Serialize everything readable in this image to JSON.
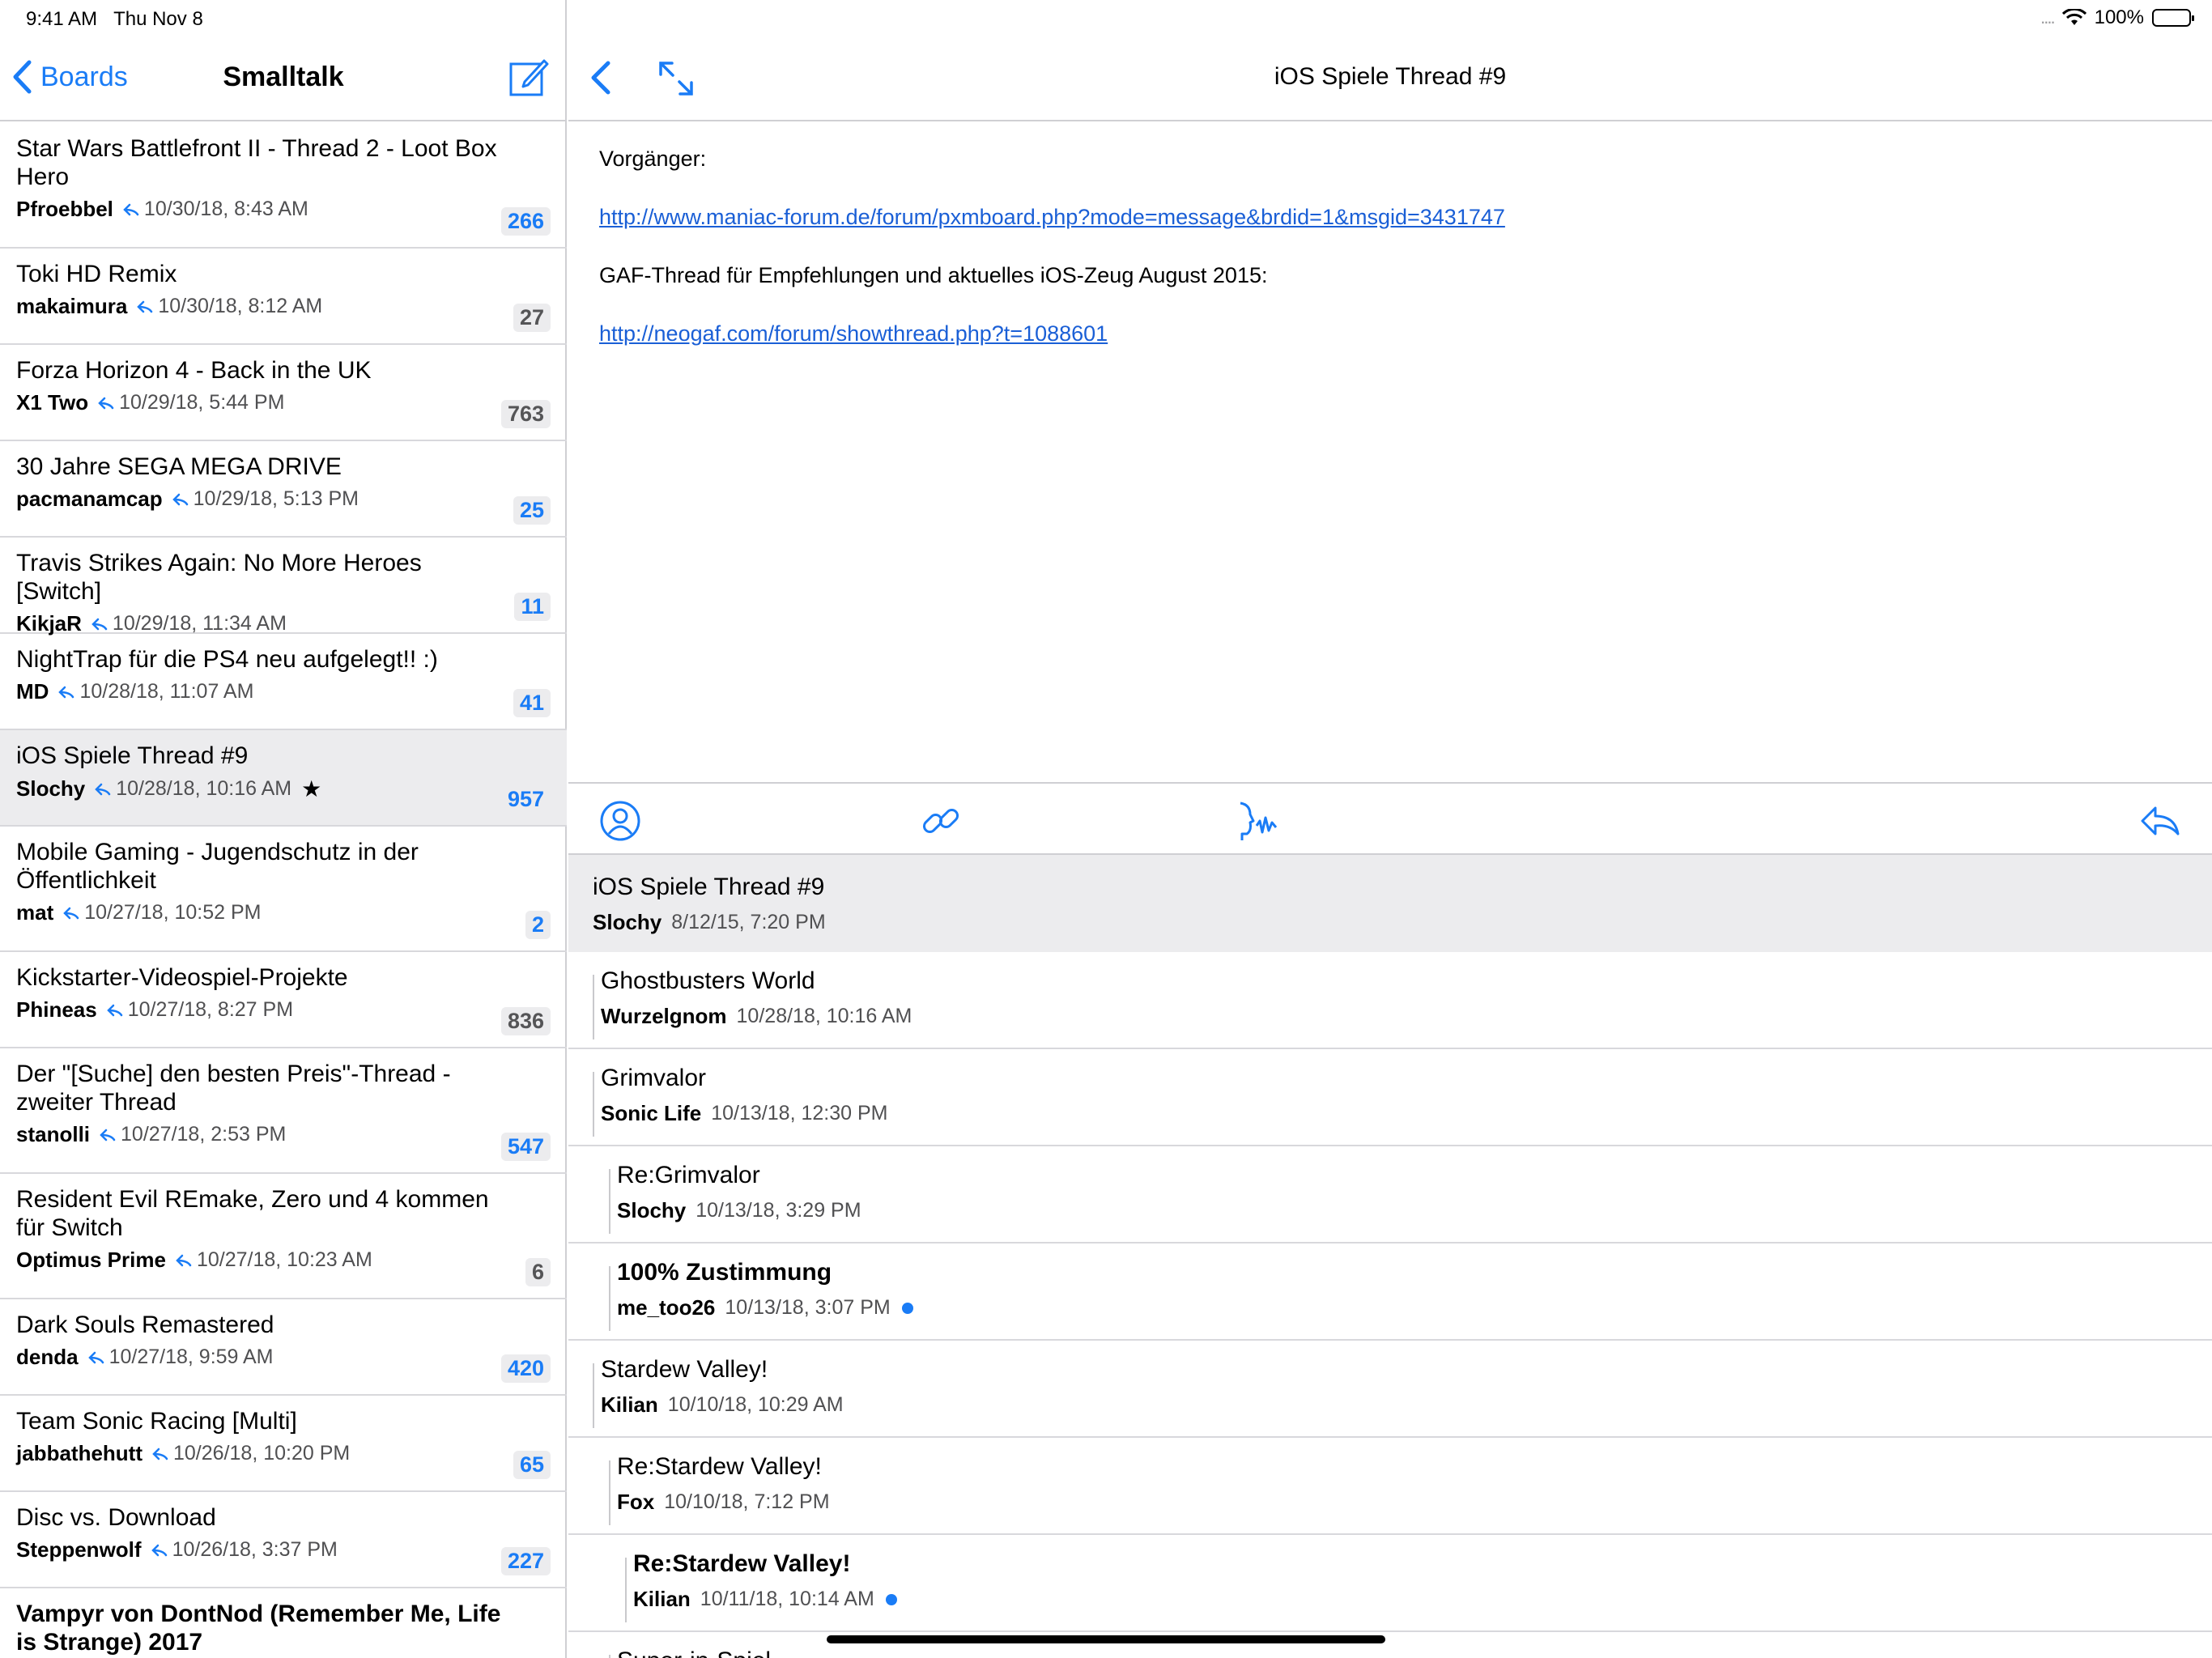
{
  "status_bar": {
    "time": "9:41 AM",
    "date": "Thu Nov 8",
    "signal": "....",
    "battery": "100%"
  },
  "sidebar": {
    "back_label": "Boards",
    "title": "Smalltalk",
    "threads": [
      {
        "title": "Star Wars Battlefront II - Thread 2 - Loot Box Hero",
        "author": "Pfroebbel",
        "date": "10/30/18, 8:43 AM",
        "count": "266",
        "count_color": "blue",
        "lines": 2
      },
      {
        "title": "Toki HD Remix",
        "author": "makaimura",
        "date": "10/30/18, 8:12 AM",
        "count": "27",
        "count_color": "gray",
        "lines": 1
      },
      {
        "title": "Forza Horizon 4 - Back in the UK",
        "author": "X1 Two",
        "date": "10/29/18, 5:44 PM",
        "count": "763",
        "count_color": "gray",
        "lines": 1
      },
      {
        "title": "30 Jahre SEGA MEGA DRIVE",
        "author": "pacmanamcap",
        "date": "10/29/18, 5:13 PM",
        "count": "25",
        "count_color": "blue",
        "lines": 1
      },
      {
        "title": "Travis Strikes Again: No More Heroes [Switch]",
        "author": "KikjaR",
        "date": "10/29/18, 11:34 AM",
        "count": "11",
        "count_color": "blue",
        "lines": 1
      },
      {
        "title": "NightTrap für die PS4 neu aufgelegt!! :)",
        "author": "MD",
        "date": "10/28/18, 11:07 AM",
        "count": "41",
        "count_color": "blue",
        "lines": 1
      },
      {
        "title": "iOS Spiele Thread #9",
        "author": "Slochy",
        "date": "10/28/18, 10:16 AM",
        "count": "957",
        "count_color": "blue",
        "lines": 1,
        "selected": true,
        "starred": true
      },
      {
        "title": "Mobile Gaming - Jugendschutz in der Öffentlichkeit",
        "author": "mat",
        "date": "10/27/18, 10:52 PM",
        "count": "2",
        "count_color": "blue",
        "lines": 2
      },
      {
        "title": "Kickstarter-Videospiel-Projekte",
        "author": "Phineas",
        "date": "10/27/18, 8:27 PM",
        "count": "836",
        "count_color": "gray",
        "lines": 1
      },
      {
        "title": "Der \"[Suche] den besten Preis\"-Thread - zweiter Thread",
        "author": "stanolli",
        "date": "10/27/18, 2:53 PM",
        "count": "547",
        "count_color": "blue",
        "lines": 2
      },
      {
        "title": "Resident Evil REmake, Zero und 4 kommen für Switch",
        "author": "Optimus Prime",
        "date": "10/27/18, 10:23 AM",
        "count": "6",
        "count_color": "gray",
        "lines": 2
      },
      {
        "title": "Dark Souls Remastered",
        "author": "denda",
        "date": "10/27/18, 9:59 AM",
        "count": "420",
        "count_color": "blue",
        "lines": 1
      },
      {
        "title": "Team Sonic Racing [Multi]",
        "author": "jabbathehutt",
        "date": "10/26/18, 10:20 PM",
        "count": "65",
        "count_color": "blue",
        "lines": 1
      },
      {
        "title": "Disc vs. Download",
        "author": "Steppenwolf",
        "date": "10/26/18, 3:37 PM",
        "count": "227",
        "count_color": "blue",
        "lines": 1
      },
      {
        "title": "Vampyr von DontNod (Remember Me, Life is Strange) 2017",
        "author": "",
        "date": "",
        "count": "",
        "count_color": "blue",
        "lines": 2,
        "bold": true
      }
    ]
  },
  "detail": {
    "title": "iOS Spiele Thread #9",
    "body": {
      "line1": "Vorgänger:",
      "link1": "http://www.maniac-forum.de/forum/pxmboard.php?mode=message&brdid=1&msgid=3431747",
      "line2": "GAF-Thread für Empfehlungen und aktuelles iOS-Zeug August 2015:",
      "link2": "http://neogaf.com/forum/showthread.php?t=1088601"
    },
    "root": {
      "title": "iOS Spiele Thread #9",
      "author": "Slochy",
      "date": "8/12/15, 7:20 PM"
    },
    "replies": [
      {
        "title": "Ghostbusters World",
        "author": "Wurzelgnom",
        "date": "10/28/18, 10:16 AM",
        "level": 1,
        "unread": false
      },
      {
        "title": "Grimvalor",
        "author": "Sonic Life",
        "date": "10/13/18, 12:30 PM",
        "level": 1,
        "unread": false
      },
      {
        "title": "Re:Grimvalor",
        "author": "Slochy",
        "date": "10/13/18, 3:29 PM",
        "level": 2,
        "unread": false
      },
      {
        "title": "100% Zustimmung",
        "author": "me_too26",
        "date": "10/13/18, 3:07 PM",
        "level": 2,
        "unread": true
      },
      {
        "title": "Stardew Valley!",
        "author": "Kilian",
        "date": "10/10/18, 10:29 AM",
        "level": 1,
        "unread": false
      },
      {
        "title": "Re:Stardew Valley!",
        "author": "Fox",
        "date": "10/10/18, 7:12 PM",
        "level": 2,
        "unread": false
      },
      {
        "title": "Re:Stardew Valley!",
        "author": "Kilian",
        "date": "10/11/18, 10:14 AM",
        "level": 3,
        "unread": true
      },
      {
        "title": "Super-in-Spiel",
        "author": "",
        "date": "",
        "level": 2,
        "unread": false
      }
    ]
  },
  "colors": {
    "accent": "#1a7cf6",
    "link": "#1a5fd6",
    "selected_bg": "#ececee"
  }
}
